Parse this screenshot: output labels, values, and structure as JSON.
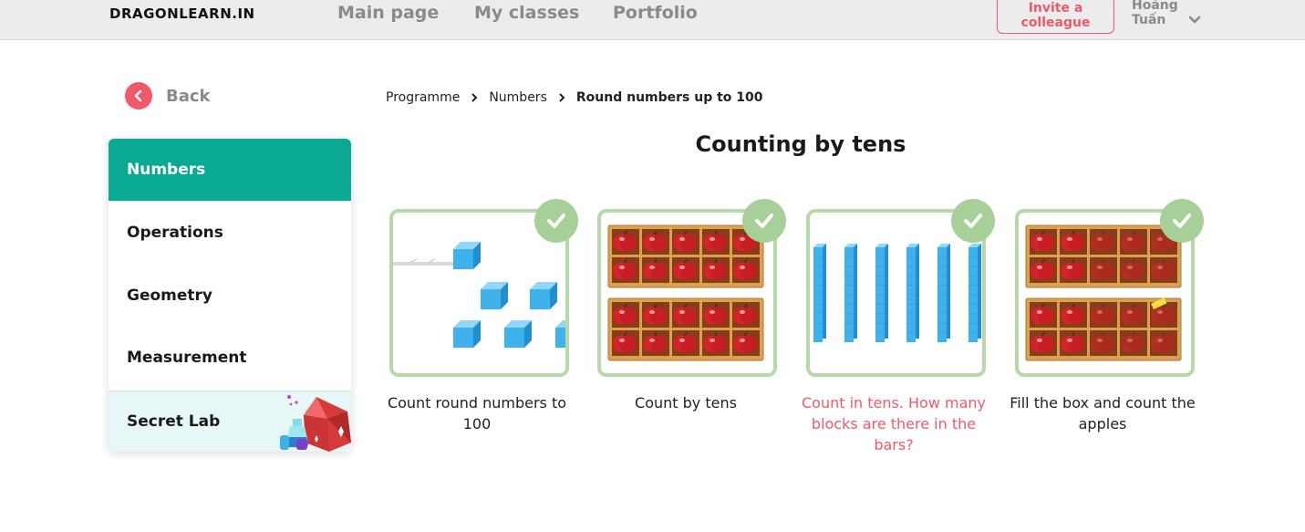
{
  "header": {
    "logo": "DRAGONLEARN.IN",
    "nav": [
      {
        "label": "Main page"
      },
      {
        "label": "My classes"
      },
      {
        "label": "Portfolio"
      }
    ],
    "invite_label": "Invite a colleague",
    "user_first": "Hoàng",
    "user_last": "Tuấn"
  },
  "back_label": "Back",
  "sidebar": {
    "items": [
      {
        "label": "Numbers",
        "active": true
      },
      {
        "label": "Operations"
      },
      {
        "label": "Geometry"
      },
      {
        "label": "Measurement"
      },
      {
        "label": "Secret Lab"
      }
    ]
  },
  "breadcrumb": [
    "Programme",
    "Numbers",
    "Round numbers up to 100"
  ],
  "page_title": "Counting by tens",
  "cards": [
    {
      "label": "Count round numbers to 100",
      "completed": true,
      "image": "blue-cubes"
    },
    {
      "label": "Count by tens",
      "completed": true,
      "image": "apple-crates"
    },
    {
      "label": "Count in tens. How many blocks are there in the bars?",
      "completed": true,
      "image": "blue-bars",
      "highlight": true
    },
    {
      "label": "Fill the box and count the apples",
      "completed": true,
      "image": "apple-crates-faded"
    }
  ],
  "colors": {
    "accent": "#0aa992",
    "brand_red": "#f0596a",
    "check_green": "#a7d098",
    "card_border": "#b5d9a8"
  },
  "icons": {
    "back": "chevron-left-icon",
    "user_menu": "chevron-down-icon",
    "completed": "check-icon"
  }
}
